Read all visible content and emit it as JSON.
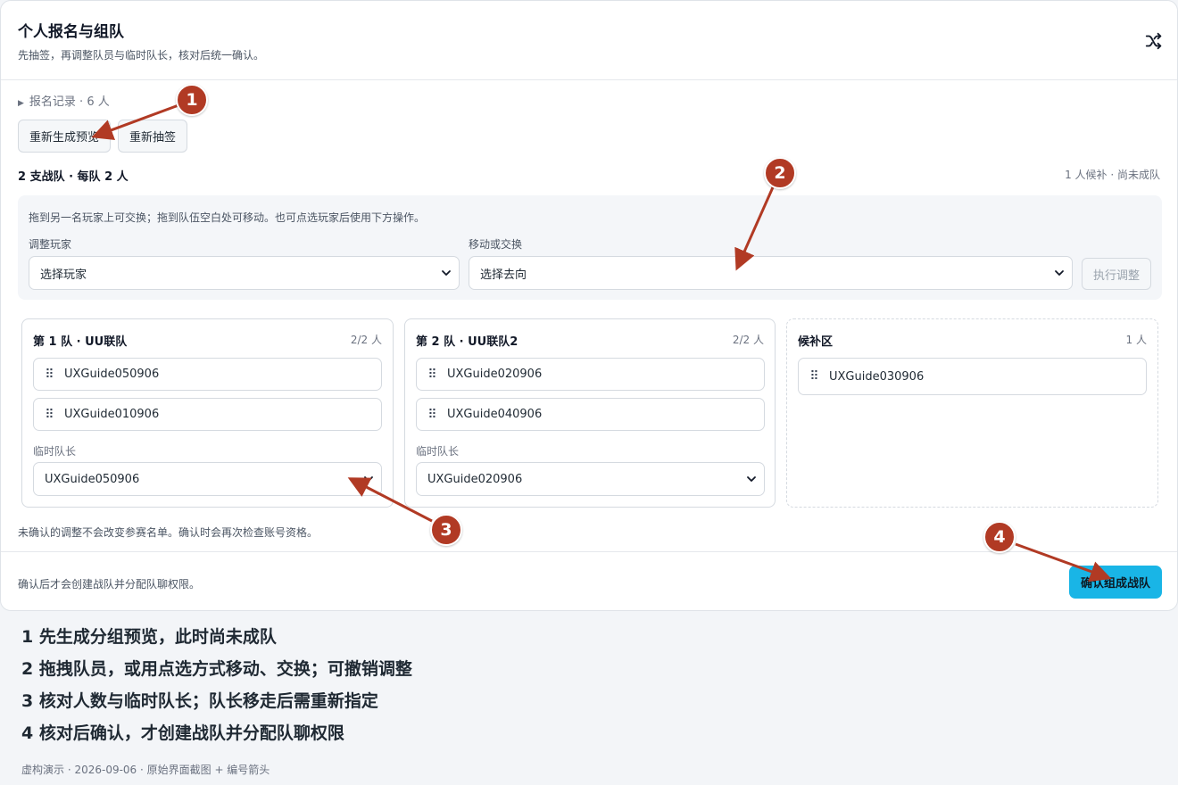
{
  "header": {
    "title": "个人报名与组队",
    "subtitle": "先抽签，再调整队员与临时队长，核对后统一确认。",
    "shuffle_icon": "shuffle-icon"
  },
  "records": {
    "label": "报名记录 · 6 人"
  },
  "actions": {
    "regen_label": "重新生成预览",
    "redraw_label": "重新抽签"
  },
  "summary": {
    "text": "2 支战队 · 每队 2 人",
    "status": "1 人候补 · 尚未成队"
  },
  "adjust": {
    "hint": "拖到另一名玩家上可交换；拖到队伍空白处可移动。也可点选玩家后使用下方操作。",
    "player_label": "调整玩家",
    "player_value": "选择玩家",
    "move_label": "移动或交换",
    "move_value": "选择去向",
    "exec_label": "执行调整"
  },
  "teams": [
    {
      "name": "第 1 队 · UU联队",
      "count": "2/2 人",
      "players": [
        "UXGuide050906",
        "UXGuide010906"
      ],
      "captain_label": "临时队长",
      "captain": "UXGuide050906"
    },
    {
      "name": "第 2 队 · UU联队2",
      "count": "2/2 人",
      "players": [
        "UXGuide020906",
        "UXGuide040906"
      ],
      "captain_label": "临时队长",
      "captain": "UXGuide020906"
    }
  ],
  "bench": {
    "name": "候补区",
    "count": "1 人",
    "players": [
      "UXGuide030906"
    ]
  },
  "note": "未确认的调整不会改变参赛名单。确认时会再次检查账号资格。",
  "footer": {
    "note": "确认后才会创建战队并分配队聊权限。",
    "confirm_label": "确认组成战队"
  },
  "legend": [
    "1 先生成分组预览，此时尚未成队",
    "2 拖拽队员，或用点选方式移动、交换；可撤销调整",
    "3 核对人数与临时队长；队长移走后需重新指定",
    "4 核对后确认，才创建战队并分配队聊权限"
  ],
  "caption": "虚构演示 · 2026-09-06 · 原始界面截图 + 编号箭头",
  "callouts": [
    "1",
    "2",
    "3",
    "4"
  ],
  "colors": {
    "accent": "#19b5e6",
    "callout": "#b13a24"
  }
}
